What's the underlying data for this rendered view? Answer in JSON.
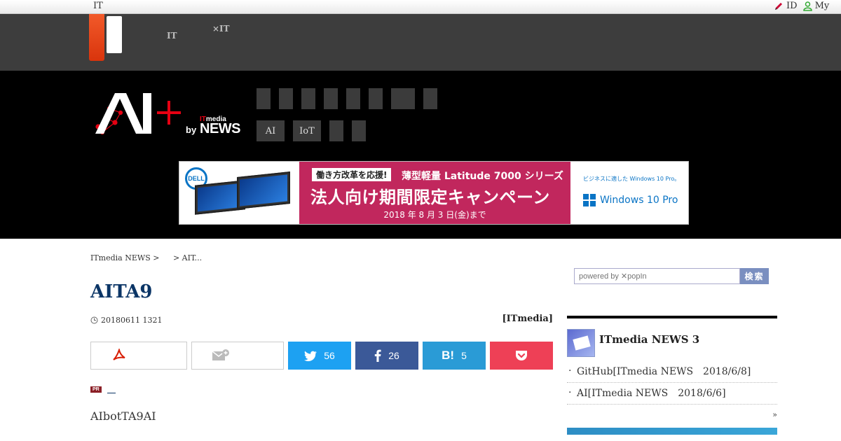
{
  "topbar": {
    "site": "IT",
    "id_link": "ID",
    "my_link": "My"
  },
  "gheader": {
    "nav1_top": "",
    "nav1_bottom": "IT",
    "nav2_top": "",
    "nav2_bottom": "×IT"
  },
  "hero": {
    "logo": "AI+",
    "logo_brand_it": "IT",
    "logo_brand_media": "media",
    "logo_by": "by",
    "logo_news": "NEWS",
    "categories_row2": [
      "AI",
      "IoT",
      "",
      ""
    ]
  },
  "ad": {
    "brand": "DELL",
    "tag": "働き方改革を応援!",
    "sub": "薄型軽量 Latitude 7000 シリーズ",
    "main": "法人向け期間限定キャンペーン",
    "date": "2018 年 8 月 3 日(金)まで",
    "right_tagline": "ビジネスに適した Windows 10 Pro。",
    "right_product": "Windows 10 Pro"
  },
  "breadcrumb": {
    "home": "ITmedia NEWS >",
    "current": "> AIT..."
  },
  "search": {
    "placeholder": "powered by ✕popIn",
    "button": "検索"
  },
  "article": {
    "title": "AITA9",
    "date": "20180611 1321",
    "author": "[ITmedia]",
    "pr_badge": "PR",
    "pr_link": "",
    "lead": "AIbotTA9AI"
  },
  "share": {
    "twitter_count": "56",
    "facebook_count": "26",
    "hatena_count": "5"
  },
  "sidebar": {
    "title": "ITmedia NEWS 3",
    "items": [
      "GitHub[ITmedia NEWS　2018/6/8]",
      "AI[ITmedia NEWS　2018/6/6]"
    ],
    "more": "»"
  },
  "colors": {
    "accent_red": "#e60012",
    "title_blue": "#0b3566",
    "twitter": "#1da1f2",
    "facebook": "#3b5998",
    "hatena": "#2a9bd6",
    "pocket": "#ee4056"
  }
}
